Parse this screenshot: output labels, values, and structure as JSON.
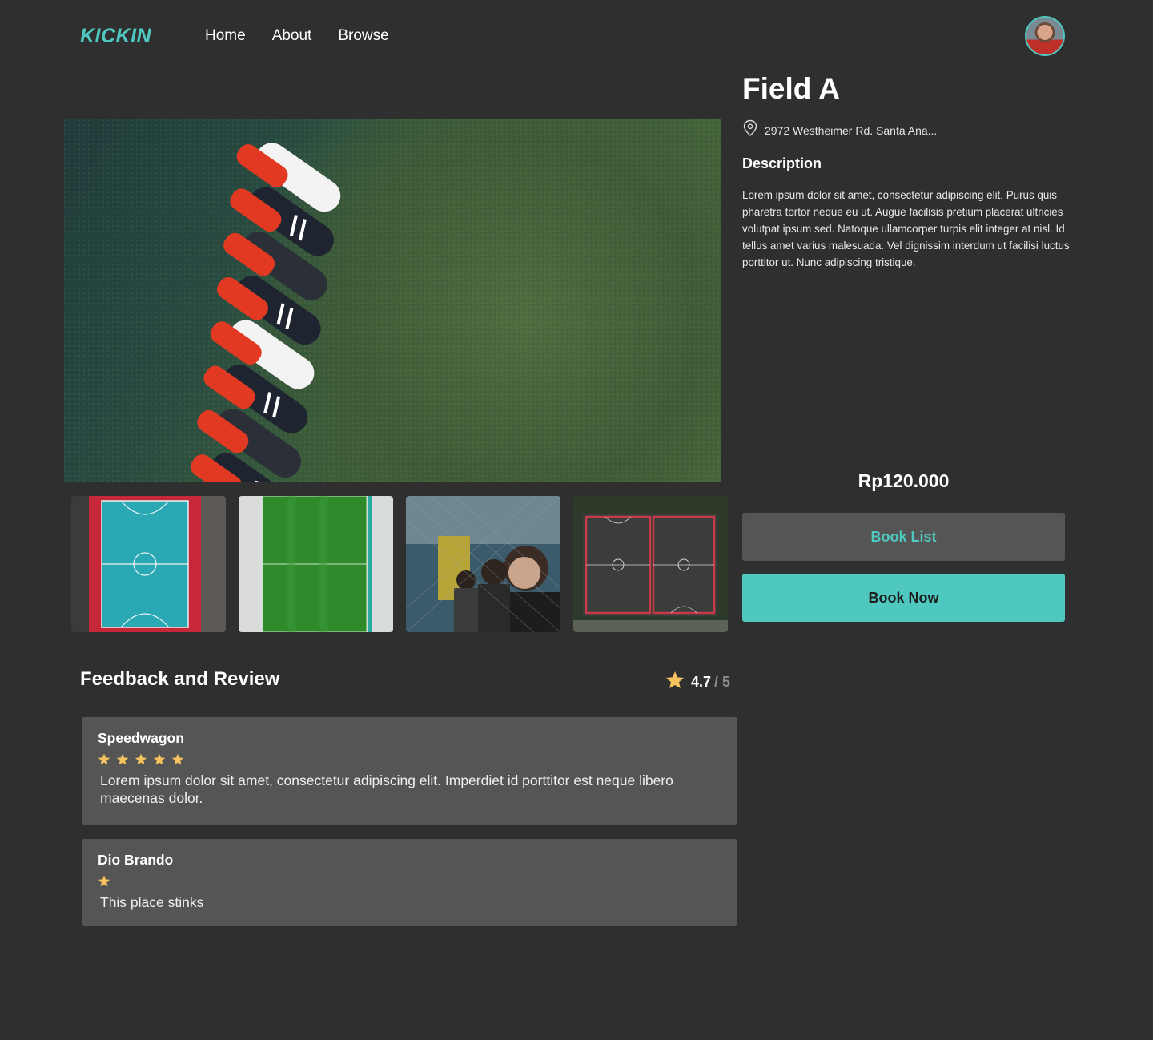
{
  "brand": {
    "logo_text": "KICKIN",
    "accent": "#4fc8bf"
  },
  "nav": {
    "items": [
      "Home",
      "About",
      "Browse"
    ]
  },
  "field": {
    "title": "Field A",
    "address": "2972 Westheimer Rd. Santa Ana...",
    "description_title": "Description",
    "description": "Lorem ipsum dolor sit amet, consectetur adipiscing elit. Purus quis pharetra tortor neque eu ut. Augue facilisis pretium placerat ultricies volutpat ipsum sed. Natoque ullamcorper turpis elit integer at nisl. Id tellus amet varius malesuada. Vel dignissim interdum ut facilisi luctus porttitor ut. Nunc adipiscing tristique.",
    "price": "Rp120.000"
  },
  "actions": {
    "book_list": "Book List",
    "book_now": "Book Now"
  },
  "feedback": {
    "title": "Feedback and Review",
    "rating": "4.7",
    "rating_max": "/ 5",
    "star_color": "#f7c35f",
    "reviews": [
      {
        "name": "Speedwagon",
        "stars": 5,
        "text": "Lorem ipsum dolor sit amet, consectetur adipiscing elit. Imperdiet id porttitor est neque libero maecenas dolor."
      },
      {
        "name": "Dio Brando",
        "stars": 1,
        "text": "This place stinks"
      }
    ]
  }
}
